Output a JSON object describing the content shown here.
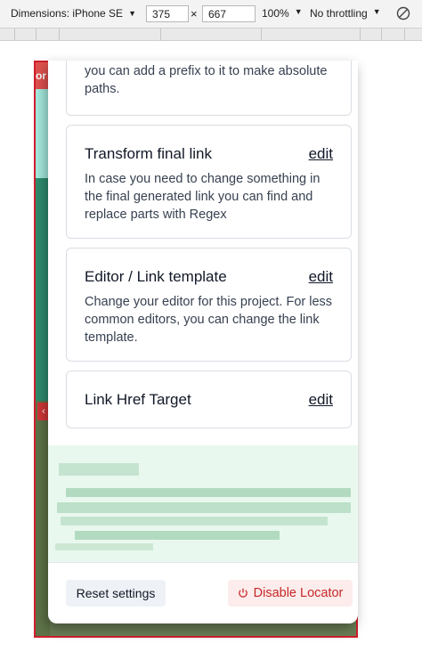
{
  "devtools": {
    "device_label": "Dimensions: iPhone SE",
    "width_value": "375",
    "times": "×",
    "height_value": "667",
    "zoom_label": "100%",
    "throttle_label": "No throttling",
    "caret": "▼"
  },
  "page": {
    "strip_text": "or",
    "collapse_tab": "‹"
  },
  "panel": {
    "top_card": {
      "description": "you can add a prefix to it to make absolute paths."
    },
    "cards": [
      {
        "title": "Transform final link",
        "edit_label": "edit",
        "description": "In case you need to change something in the final generated link you can find and replace parts with Regex"
      },
      {
        "title": "Editor / Link template",
        "edit_label": "edit",
        "description": "Change your editor for this project. For less common editors, you can change the link template."
      },
      {
        "title": "Link Href Target",
        "edit_label": "edit"
      }
    ],
    "footer": {
      "reset_label": "Reset settings",
      "disable_label": "Disable Locator"
    }
  },
  "colors": {
    "accent_red": "#c62828",
    "frame_border": "#d01f2c",
    "blurred_bg": "#e9f8ee"
  }
}
